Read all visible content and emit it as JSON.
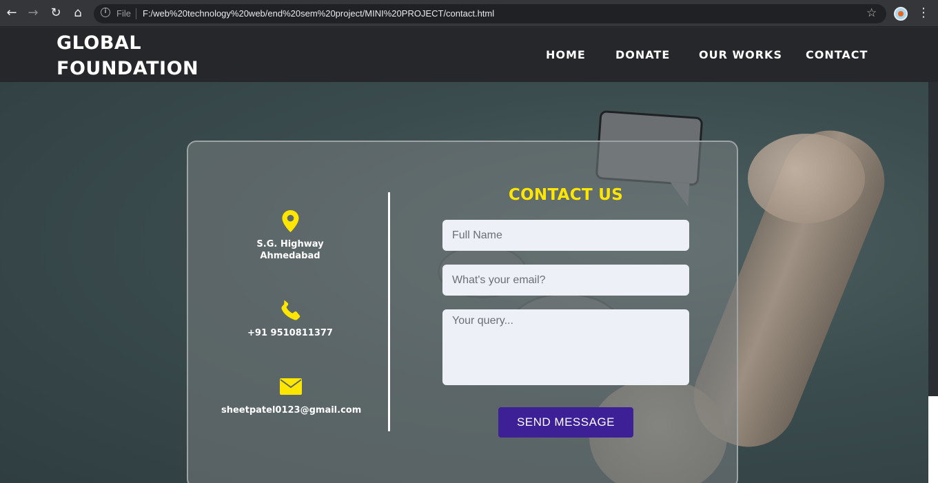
{
  "browser": {
    "info_label": "File",
    "url": "F:/web%20technology%20web/end%20sem%20project/MINI%20PROJECT/contact.html",
    "back_icon": "arrow-left-icon",
    "forward_icon": "arrow-right-icon",
    "reload_icon": "reload-icon",
    "home_icon": "home-icon"
  },
  "header": {
    "brand_line1": "GLOBAL",
    "brand_line2": "FOUNDATION",
    "nav": [
      {
        "label": "HOME"
      },
      {
        "label": "DONATE"
      },
      {
        "label": "OUR WORKS"
      },
      {
        "label": "CONTACT"
      }
    ]
  },
  "contact": {
    "title": "CONTACT US",
    "address_line1": "S.G. Highway",
    "address_line2": "Ahmedabad",
    "phone": "+91 9510811377",
    "email": "sheetpatel0123@gmail.com",
    "form": {
      "name_placeholder": "Full Name",
      "email_placeholder": "What's your email?",
      "query_placeholder": "Your query...",
      "submit_label": "SEND MESSAGE"
    }
  },
  "colors": {
    "accent_yellow": "#ffe600",
    "button_purple": "#3d1f96",
    "header_bg": "#25272b"
  }
}
